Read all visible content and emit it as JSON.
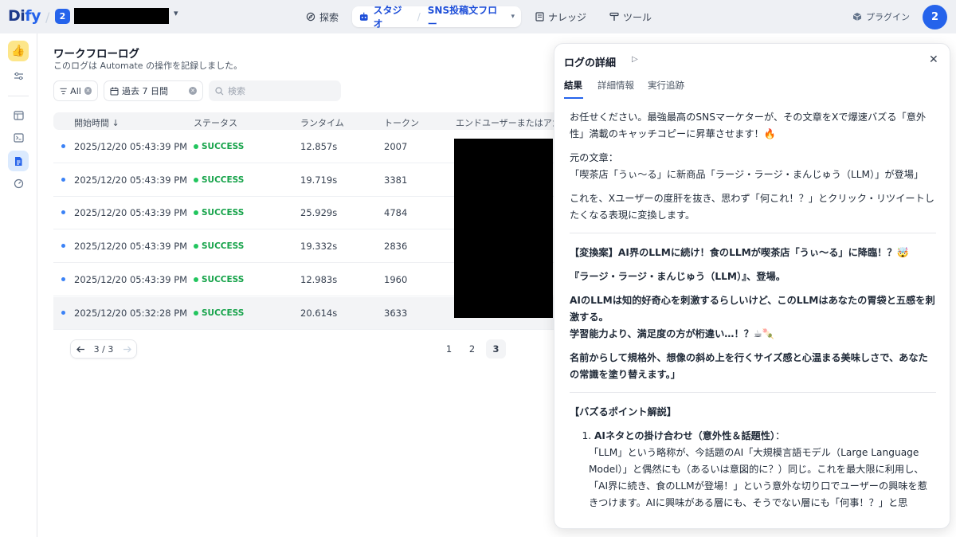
{
  "topbar": {
    "logo_prefix": "Di",
    "logo_suffix": "fy",
    "workspace_badge": "2",
    "nav": {
      "explore": "探索",
      "studio": "スタジオ",
      "app_name": "SNS投稿文フロー",
      "knowledge": "ナレッジ",
      "tools": "ツール",
      "plugins": "プラグイン"
    },
    "avatar": "2"
  },
  "main": {
    "title": "ワークフローログ",
    "subtitle": "このログは Automate の操作を記録しました。",
    "filters": {
      "status": "All",
      "period": "過去 7 日間",
      "search_placeholder": "検索"
    },
    "columns": {
      "start_time": "開始時間 ↓",
      "status": "ステータス",
      "runtime": "ランタイム",
      "tokens": "トークン",
      "end_user": "エンドユーザーまたはアカ"
    },
    "rows": [
      {
        "time": "2025/12/20 05:43:39 PM",
        "status": "SUCCESS",
        "runtime": "12.857s",
        "tokens": "2007"
      },
      {
        "time": "2025/12/20 05:43:39 PM",
        "status": "SUCCESS",
        "runtime": "19.719s",
        "tokens": "3381"
      },
      {
        "time": "2025/12/20 05:43:39 PM",
        "status": "SUCCESS",
        "runtime": "25.929s",
        "tokens": "4784"
      },
      {
        "time": "2025/12/20 05:43:39 PM",
        "status": "SUCCESS",
        "runtime": "19.332s",
        "tokens": "2836"
      },
      {
        "time": "2025/12/20 05:43:39 PM",
        "status": "SUCCESS",
        "runtime": "12.983s",
        "tokens": "1960"
      },
      {
        "time": "2025/12/20 05:32:28 PM",
        "status": "SUCCESS",
        "runtime": "20.614s",
        "tokens": "3633"
      }
    ],
    "pagination": {
      "count": "3 / 3",
      "pages": [
        "1",
        "2",
        "3"
      ],
      "current": "3"
    }
  },
  "panel": {
    "title": "ログの詳細",
    "tabs": [
      "結果",
      "詳細情報",
      "実行追跡"
    ],
    "content": {
      "intro": "お任せください。最強最高のSNSマーケターが、その文章をXで爆速バズる「意外性」満載のキャッチコピーに昇華させます！🔥",
      "orig_label": "元の文章：",
      "orig_text": "「喫茶店「うぃ〜る」に新商品「ラージ・ラージ・まんじゅう（LLM）」が登場」",
      "explain": "これを、Xユーザーの度肝を抜き、思わず「何これ！？」とクリック・リツイートしたくなる表現に変換します。",
      "proposal_1": "【変換案】AI界のLLMに続け！食のLLMが喫茶店「うぃ〜る」に降臨！？🤯",
      "proposal_2": "『ラージ・ラージ・まんじゅう（LLM）』、登場。",
      "proposal_3a": "AIのLLMは知的好奇心を刺激するらしいけど、このLLMはあなたの胃袋と五感を刺激する。",
      "proposal_3b": "学習能力より、満足度の方が桁違い…！？☕🍡",
      "proposal_4": "名前からして規格外、想像の斜め上を行くサイズ感と心温まる美味しさで、あなたの常識を塗り替えます。」",
      "buzz_title": "【バズるポイント解説】",
      "point_1_title": "AIネタとの掛け合わせ（意外性＆話題性）",
      "point_1_colon": "：",
      "point_1_body": "「LLM」という略称が、今話題のAI「大規模言語モデル（Large Language Model）」と偶然にも（あるいは意図的に？）同じ。これを最大限に利用し、「AI界に続き、食のLLMが登場！」という意外な切り口でユーザーの興味を惹きつけます。AIに興味がある層にも、そうでない層にも「何事！？」と思"
    }
  }
}
